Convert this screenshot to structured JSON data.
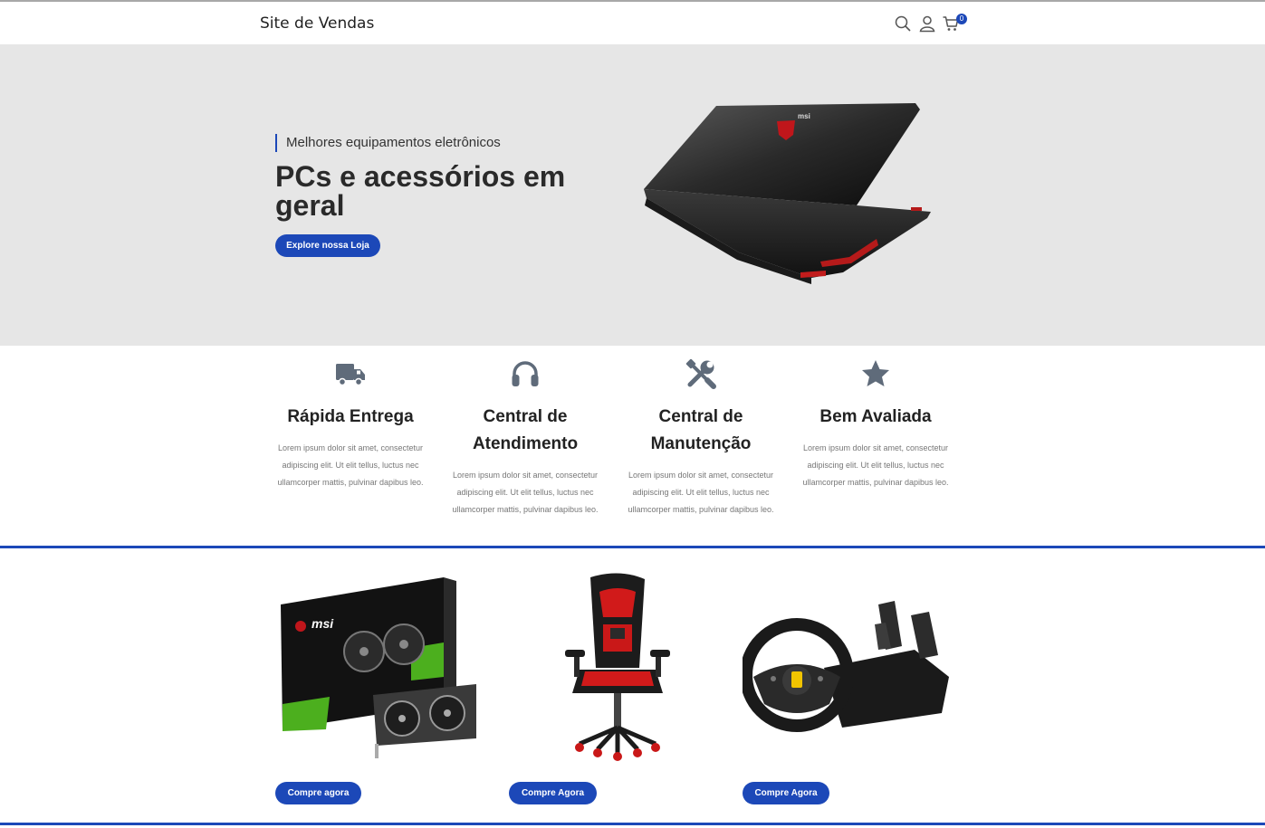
{
  "header": {
    "brand": "Site de Vendas",
    "icons": [
      "search-icon",
      "user-icon",
      "cart-icon"
    ],
    "cart_count": "0"
  },
  "hero": {
    "kicker": "Melhores equipamentos eletrônicos",
    "title": "PCs e acessórios em geral",
    "cta": "Explore nossa Loja",
    "image": "laptop-image"
  },
  "features": [
    {
      "icon": "truck-icon",
      "title": "Rápida Entrega",
      "text": "Lorem ipsum dolor sit amet, consectetur adipiscing elit. Ut elit tellus, luctus nec ullamcorper mattis, pulvinar dapibus leo."
    },
    {
      "icon": "headset-icon",
      "title": "Central de Atendimento",
      "text": "Lorem ipsum dolor sit amet, consectetur adipiscing elit. Ut elit tellus, luctus nec ullamcorper mattis, pulvinar dapibus leo."
    },
    {
      "icon": "tools-icon",
      "title": "Central de Manutenção",
      "text": "Lorem ipsum dolor sit amet, consectetur adipiscing elit. Ut elit tellus, luctus nec ullamcorper mattis, pulvinar dapibus leo."
    },
    {
      "icon": "star-icon",
      "title": "Bem Avaliada",
      "text": "Lorem ipsum dolor sit amet, consectetur adipiscing elit. Ut elit tellus, luctus nec ullamcorper mattis, pulvinar dapibus leo."
    }
  ],
  "products": [
    {
      "image": "graphics-card-image",
      "button": "Compre agora"
    },
    {
      "image": "gaming-chair-image",
      "button": "Compre Agora"
    },
    {
      "image": "steering-wheel-image",
      "button": "Compre Agora"
    }
  ],
  "colors": {
    "accent": "#1c48b8",
    "hero_bg": "#e6e6e6",
    "icon_gray": "#5f6b7a"
  }
}
